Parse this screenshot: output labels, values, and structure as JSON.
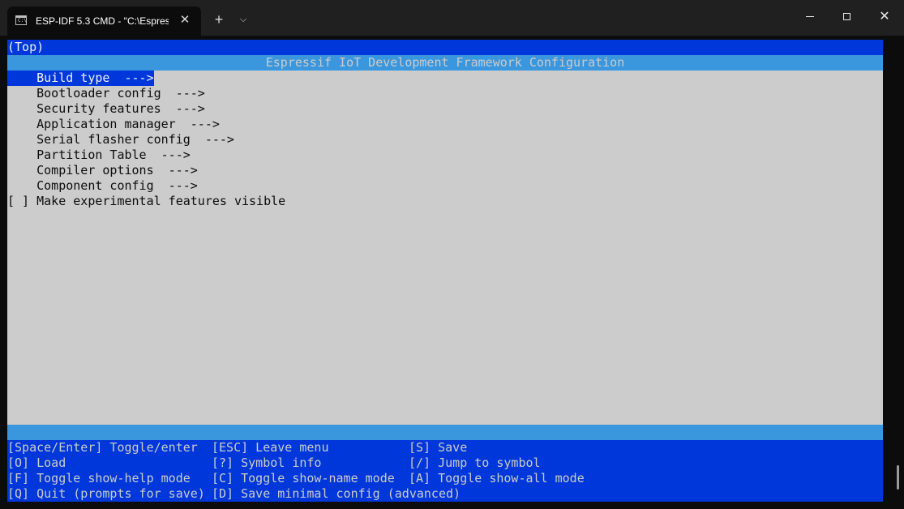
{
  "window": {
    "tab_title": "ESP-IDF 5.3 CMD - \"C:\\Espres",
    "tab_icon_text": "C:\\",
    "tab_close_glyph": "✕",
    "new_tab_glyph": "+",
    "dropdown_glyph": "⌵",
    "close_glyph": "✕"
  },
  "terminal": {
    "breadcrumb": "(Top)",
    "banner": "Espressif IoT Development Framework Configuration",
    "menu": [
      {
        "label": "    Build type  --->",
        "selected": true
      },
      {
        "label": "    Bootloader config  --->",
        "selected": false
      },
      {
        "label": "    Security features  --->",
        "selected": false
      },
      {
        "label": "    Application manager  --->",
        "selected": false
      },
      {
        "label": "    Serial flasher config  --->",
        "selected": false
      },
      {
        "label": "    Partition Table  --->",
        "selected": false
      },
      {
        "label": "    Compiler options  --->",
        "selected": false
      },
      {
        "label": "    Component config  --->",
        "selected": false
      },
      {
        "label": "[ ] Make experimental features visible",
        "selected": false
      }
    ],
    "help": [
      [
        "[Space/Enter] Toggle/enter",
        "[ESC] Leave menu",
        "[S] Save"
      ],
      [
        "[O] Load",
        "[?] Symbol info",
        "[/] Jump to symbol"
      ],
      [
        "[F] Toggle show-help mode",
        "[C] Toggle show-name mode",
        "[A] Toggle show-all mode"
      ],
      [
        "[Q] Quit (prompts for save)",
        "[D] Save minimal config (advanced)",
        ""
      ]
    ]
  },
  "colors": {
    "title_bar": "#202020",
    "menu_background": "#cccccc",
    "selection": "#0037da",
    "banner": "#3a96dd"
  }
}
